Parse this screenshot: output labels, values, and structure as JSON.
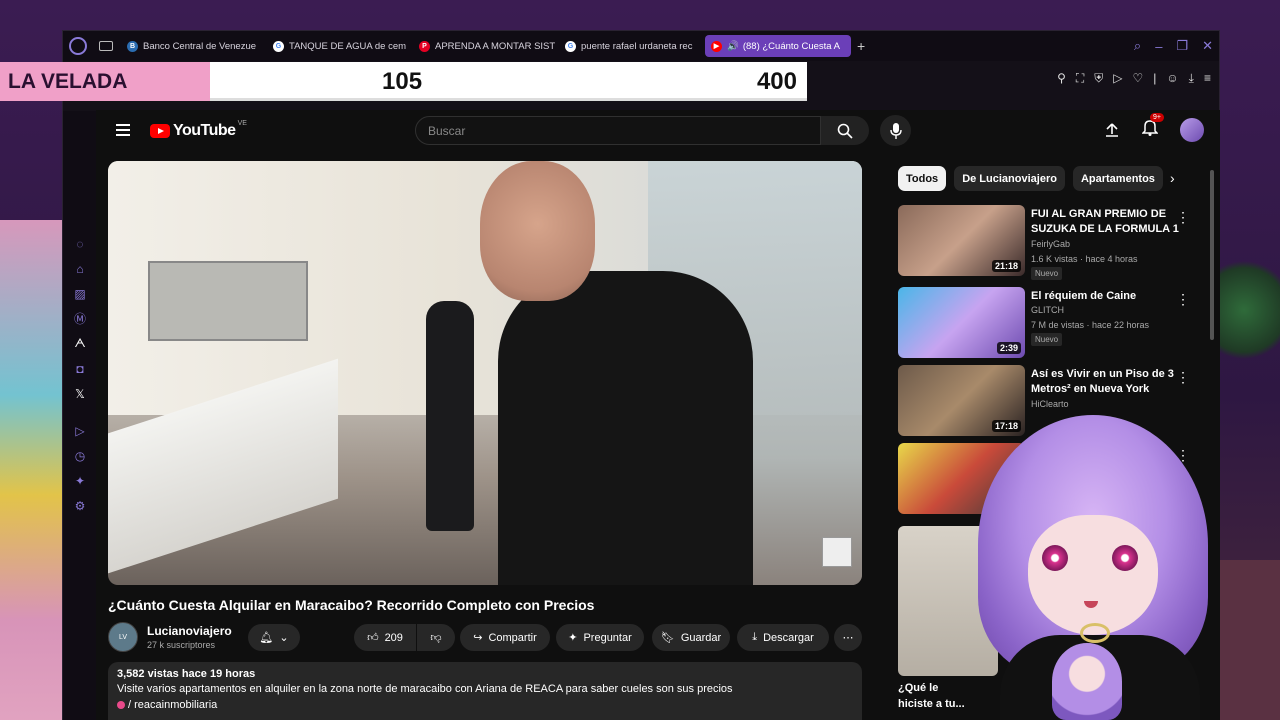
{
  "stream": {
    "score_label": "LA VELADA",
    "score_a": "105",
    "score_b": "400"
  },
  "browser": {
    "tabs": [
      {
        "label": "Banco Central de Venezue",
        "fav": "BCV",
        "color": "#2b6cb0"
      },
      {
        "label": "TANQUE DE AGUA de cem",
        "fav": "G",
        "color": "#ffffff"
      },
      {
        "label": "APRENDA A MONTAR SIST",
        "fav": "P",
        "color": "#e60023"
      },
      {
        "label": "puente rafael urdaneta rec",
        "fav": "G",
        "color": "#ffffff"
      },
      {
        "label": "(88) ¿Cuánto Cuesta A",
        "fav": "▶",
        "color": "#ff0000"
      }
    ]
  },
  "youtube": {
    "logo_text": "YouTube",
    "country_code": "VE",
    "search_placeholder": "Buscar",
    "notification_count": "9+",
    "video": {
      "title": "¿Cuánto Cuesta Alquilar en Maracaibo? Recorrido Completo con Precios",
      "channel": "Lucianoviajero",
      "subscribers": "27 k suscriptores",
      "likes": "209",
      "share_label": "Compartir",
      "ask_label": "Preguntar",
      "save_label": "Guardar",
      "download_label": "Descargar",
      "stats": "3,582 vistas  hace 19 horas",
      "description": "Visite varios apartamentos en alquiler en la zona norte de maracaibo con Ariana de REACA para saber cueles son sus precios",
      "tag": "/ reacainmobiliaria"
    },
    "chips": [
      "Todos",
      "De Lucianoviajero",
      "Apartamentos"
    ],
    "recommendations": [
      {
        "title": "FUI AL GRAN PREMIO DE SUZUKA DE LA FORMULA 1",
        "channel": "FeirlyGab",
        "meta": "1.6 K vistas · hace 4 horas",
        "duration": "21:18",
        "badge": "Nuevo"
      },
      {
        "title": "El réquiem de Caine",
        "channel": "GLITCH",
        "meta": "7 M de vistas · hace 22 horas",
        "duration": "2:39",
        "badge": "Nuevo"
      },
      {
        "title": "Así es Vivir en un Piso de 3 Metros² en Nueva York",
        "channel": "HiClearto",
        "meta": "",
        "duration": "17:18",
        "badge": ""
      },
      {
        "title": "",
        "channel": "",
        "meta": "",
        "duration": "",
        "badge": ""
      }
    ],
    "short_title": "¿Qué le hiciste a tu..."
  }
}
